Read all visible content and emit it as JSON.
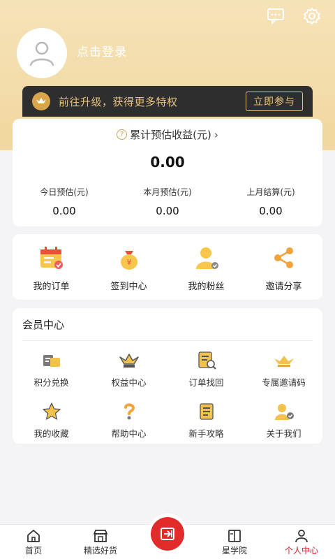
{
  "header": {
    "login_text": "点击登录",
    "icons": [
      "message-icon",
      "settings-icon"
    ],
    "colors": {
      "gold": "#f0d79f",
      "dark": "#2e2e2e",
      "accent": "#e7c17b"
    }
  },
  "vip_banner": {
    "text": "前往升级，获得更多特权",
    "button": "立即参与"
  },
  "earnings": {
    "title": "累计预估收益(元)",
    "total": "0.00",
    "columns": [
      {
        "label": "今日预估(元)",
        "value": "0.00"
      },
      {
        "label": "本月预估(元)",
        "value": "0.00"
      },
      {
        "label": "上月结算(元)",
        "value": "0.00"
      }
    ]
  },
  "quick_actions": [
    {
      "label": "我的订单",
      "icon": "calendar-icon"
    },
    {
      "label": "签到中心",
      "icon": "money-bag-icon"
    },
    {
      "label": "我的粉丝",
      "icon": "user-icon"
    },
    {
      "label": "邀请分享",
      "icon": "share-icon"
    }
  ],
  "member_center": {
    "title": "会员中心",
    "items": [
      {
        "label": "积分兑换",
        "icon": "points-icon"
      },
      {
        "label": "权益中心",
        "icon": "crown-icon"
      },
      {
        "label": "订单找回",
        "icon": "document-search-icon"
      },
      {
        "label": "专属邀请码",
        "icon": "crown-small-icon"
      },
      {
        "label": "我的收藏",
        "icon": "star-icon"
      },
      {
        "label": "帮助中心",
        "icon": "help-icon"
      },
      {
        "label": "新手攻略",
        "icon": "guide-icon"
      },
      {
        "label": "关于我们",
        "icon": "about-user-icon"
      }
    ]
  },
  "tabbar": {
    "tabs": [
      {
        "label": "首页",
        "icon": "home-icon"
      },
      {
        "label": "精选好货",
        "icon": "store-icon"
      },
      {
        "label": "星学院",
        "icon": "book-icon"
      },
      {
        "label": "个人中心",
        "icon": "person-icon"
      }
    ],
    "active": "个人中心",
    "active_color": "#d91f2a"
  }
}
